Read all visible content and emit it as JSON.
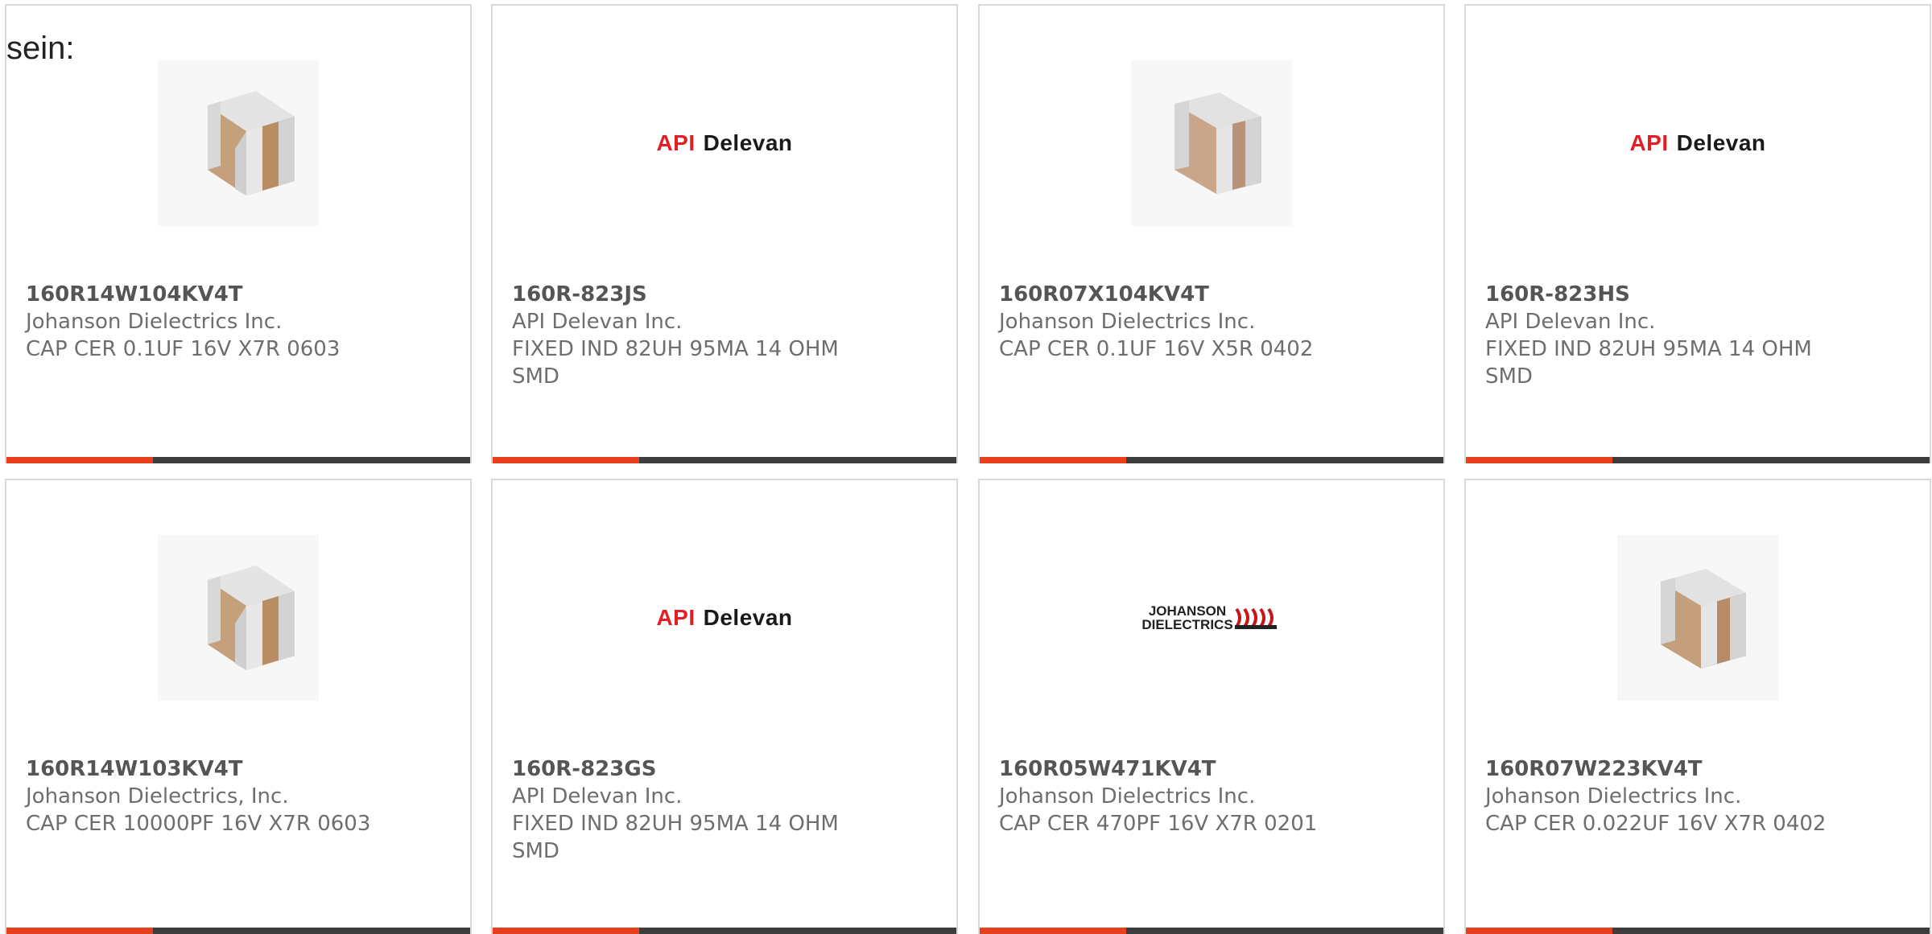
{
  "lead_text": "sein:",
  "colors": {
    "accent": "#e8401c",
    "bar": "#3d3d3d",
    "api_red": "#e31e24"
  },
  "logos": {
    "api_delevan": "API Delevan",
    "johanson_dielectrics": "JOHANSON DIELECTRICS"
  },
  "products": [
    {
      "part_number": "160R14W104KV4T",
      "manufacturer": "Johanson Dielectrics Inc.",
      "description": "CAP CER 0.1UF 16V X7R 0603",
      "image": "capacitor-chip-icon"
    },
    {
      "part_number": "160R-823JS",
      "manufacturer": "API Delevan Inc.",
      "description": "FIXED IND 82UH 95MA 14 OHM SMD",
      "image": "api-delevan-logo"
    },
    {
      "part_number": "160R07X104KV4T",
      "manufacturer": "Johanson Dielectrics Inc.",
      "description": "CAP CER 0.1UF 16V X5R 0402",
      "image": "capacitor-chip-icon"
    },
    {
      "part_number": "160R-823HS",
      "manufacturer": "API Delevan Inc.",
      "description": "FIXED IND 82UH 95MA 14 OHM SMD",
      "image": "api-delevan-logo"
    },
    {
      "part_number": "160R14W103KV4T",
      "manufacturer": "Johanson Dielectrics, Inc.",
      "description": "CAP CER 10000PF 16V X7R 0603",
      "image": "capacitor-chip-icon"
    },
    {
      "part_number": "160R-823GS",
      "manufacturer": "API Delevan Inc.",
      "description": "FIXED IND 82UH 95MA 14 OHM SMD",
      "image": "api-delevan-logo"
    },
    {
      "part_number": "160R05W471KV4T",
      "manufacturer": "Johanson Dielectrics Inc.",
      "description": "CAP CER 470PF 16V X7R 0201",
      "image": "johanson-dielectrics-logo"
    },
    {
      "part_number": "160R07W223KV4T",
      "manufacturer": "Johanson Dielectrics Inc.",
      "description": "CAP CER 0.022UF 16V X7R 0402",
      "image": "capacitor-chip-icon"
    }
  ]
}
